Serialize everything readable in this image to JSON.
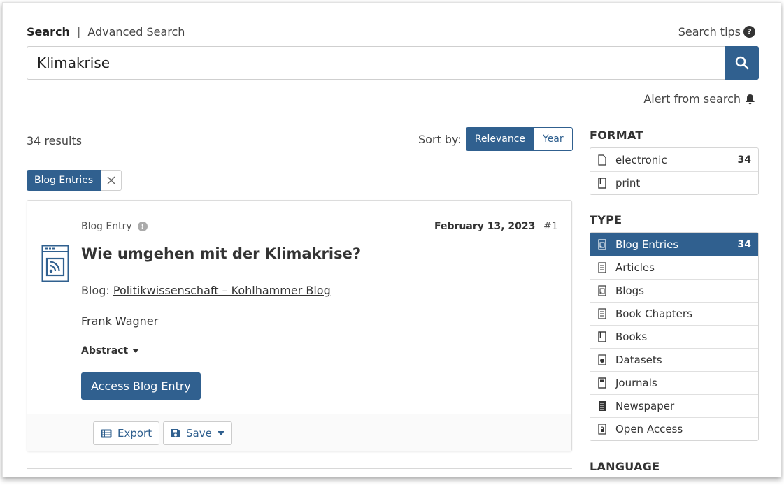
{
  "header": {
    "tab_search": "Search",
    "tab_separator": "|",
    "tab_advanced": "Advanced Search",
    "search_tips": "Search tips"
  },
  "search": {
    "value": "Klimakrise"
  },
  "alert": {
    "label": "Alert from search"
  },
  "results": {
    "count_text": "34 results",
    "sort_label": "Sort by:",
    "sort_options": [
      "Relevance",
      "Year"
    ],
    "active_sort": "Relevance",
    "filter_chip": "Blog Entries"
  },
  "result_card": {
    "format": "Blog Entry",
    "date": "February 13, 2023",
    "rank": "#1",
    "title": "Wie umgehen mit der Klimakrise?",
    "blog_prefix": "Blog:",
    "blog_name": "Politikwissenschaft – Kohlhammer Blog",
    "author": "Frank Wagner",
    "abstract_label": "Abstract",
    "access_label": "Access Blog Entry",
    "export_label": "Export",
    "save_label": "Save"
  },
  "sidebar": {
    "format_heading": "FORMAT",
    "format_items": [
      {
        "label": "electronic",
        "count": "34",
        "icon": "file-outline-icon"
      },
      {
        "label": "print",
        "count": "",
        "icon": "book-icon"
      }
    ],
    "type_heading": "TYPE",
    "type_items": [
      {
        "label": "Blog Entries",
        "count": "34",
        "icon": "rss-doc-icon",
        "selected": true
      },
      {
        "label": "Articles",
        "count": "",
        "icon": "document-icon"
      },
      {
        "label": "Blogs",
        "count": "",
        "icon": "rss-doc-icon"
      },
      {
        "label": "Book Chapters",
        "count": "",
        "icon": "document-icon"
      },
      {
        "label": "Books",
        "count": "",
        "icon": "book-icon"
      },
      {
        "label": "Datasets",
        "count": "",
        "icon": "pie-doc-icon"
      },
      {
        "label": "Journals",
        "count": "",
        "icon": "journal-icon"
      },
      {
        "label": "Newspaper",
        "count": "",
        "icon": "newspaper-icon"
      },
      {
        "label": "Open Access",
        "count": "",
        "icon": "lock-doc-icon"
      }
    ],
    "language_heading": "LANGUAGE"
  },
  "colors": {
    "primary": "#30608f",
    "text": "#333333",
    "border": "#d6d6d6"
  }
}
